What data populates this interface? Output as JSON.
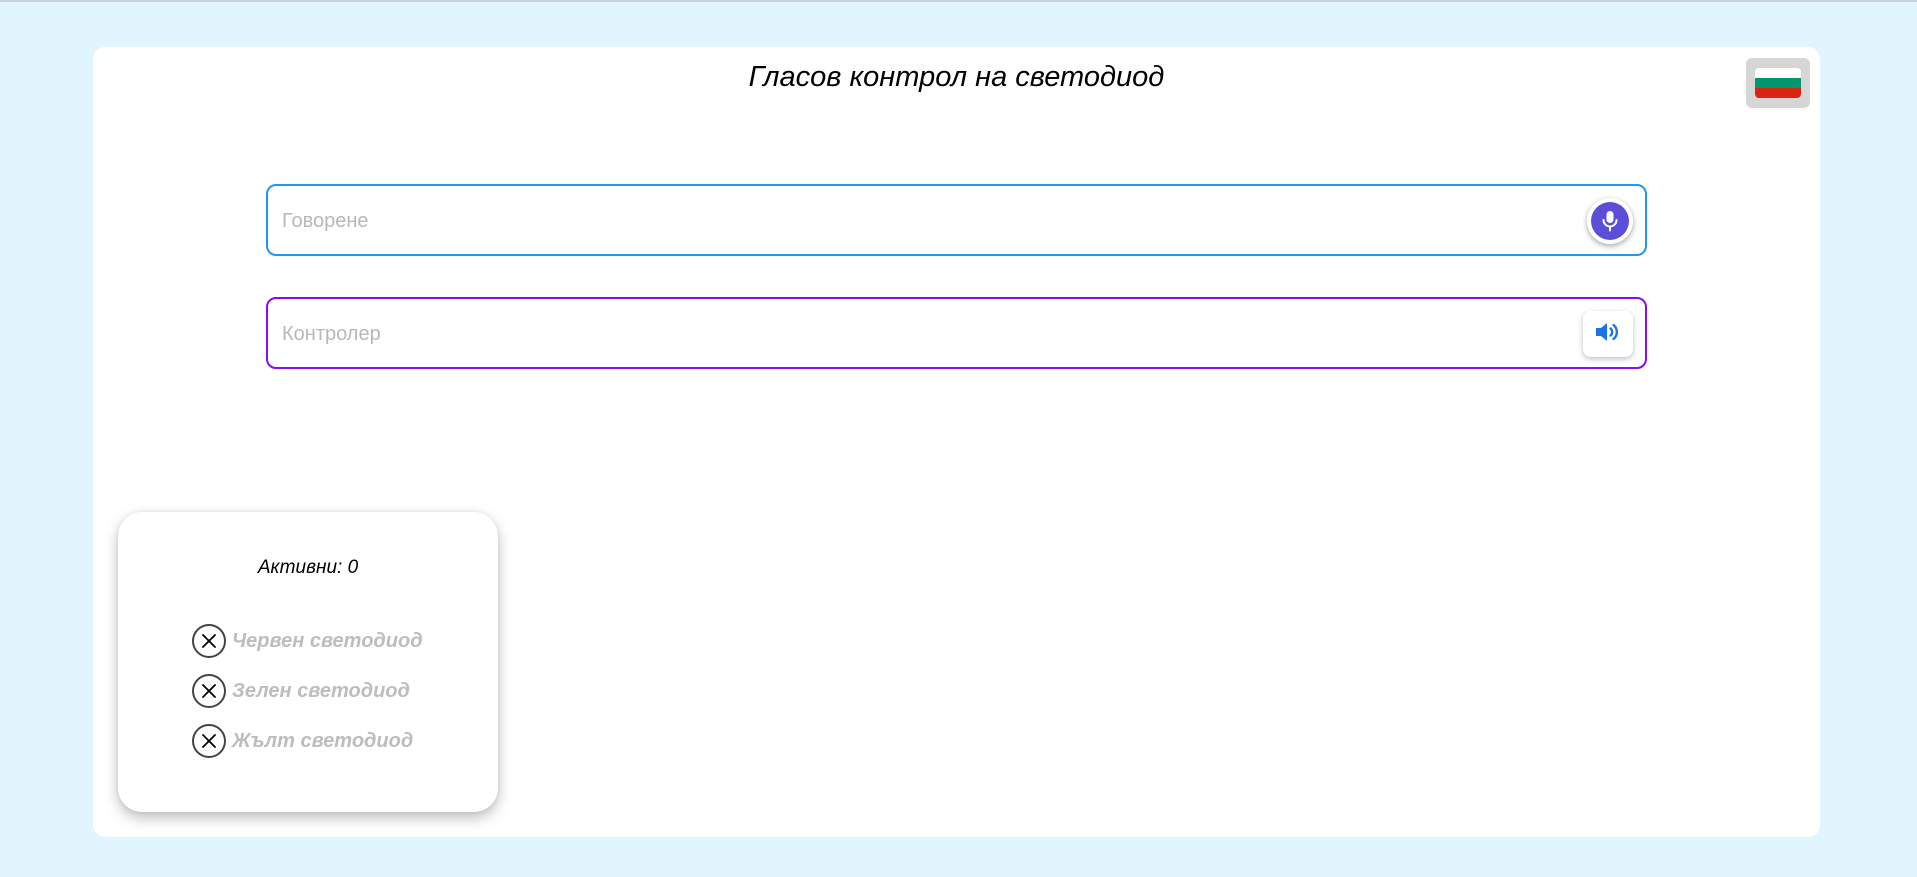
{
  "header": {
    "title": "Гласов контрол на светодиод",
    "language_icon": "bulgaria-flag-icon"
  },
  "colors": {
    "background": "#e0f5fd",
    "speech_border": "#2196f3",
    "controller_border": "#8a0cf0",
    "mic_accent": "#5b4fd9",
    "speaker_accent": "#1a73e8",
    "flag": [
      "#ffffff",
      "#00966e",
      "#d62612"
    ]
  },
  "speech_field": {
    "value": "",
    "placeholder": "Говорене",
    "button_icon": "microphone-icon"
  },
  "controller_field": {
    "value": "",
    "placeholder": "Контролер",
    "button_icon": "speaker-icon"
  },
  "status": {
    "active_label": "Активни:",
    "active_count": "0",
    "leds": [
      {
        "label": "Червен светодиод",
        "state": "off",
        "icon": "close-icon"
      },
      {
        "label": "Зелен светодиод",
        "state": "off",
        "icon": "close-icon"
      },
      {
        "label": "Жълт светодиод",
        "state": "off",
        "icon": "close-icon"
      }
    ]
  }
}
